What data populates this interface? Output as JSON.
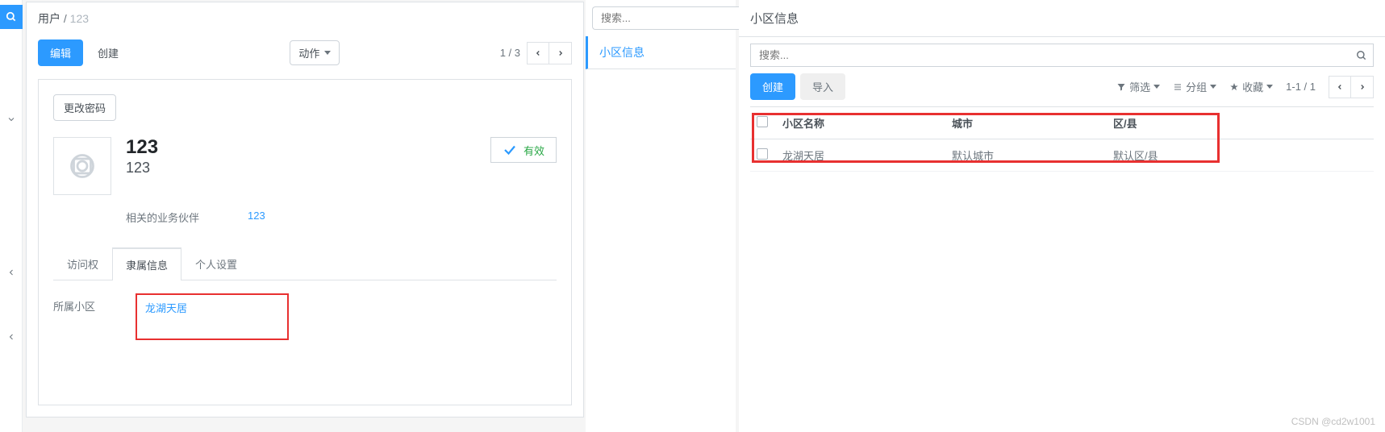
{
  "left": {
    "breadcrumb_module": "用户",
    "breadcrumb_sep": " / ",
    "breadcrumb_current": "123",
    "edit_label": "编辑",
    "create_label": "创建",
    "action_label": "动作",
    "pager": "1 / 3",
    "change_pw": "更改密码",
    "name": "123",
    "login": "123",
    "related_label": "相关的业务伙伴",
    "related_value": "123",
    "tabs": [
      "访问权",
      "隶属信息",
      "个人设置"
    ],
    "status_label": "有效",
    "field_label": "所属小区",
    "field_value": "龙湖天居"
  },
  "mid": {
    "search_placeholder": "搜索...",
    "side_link": "小区信息"
  },
  "right": {
    "title": "小区信息",
    "search_placeholder": "搜索...",
    "create_label": "创建",
    "import_label": "导入",
    "filter_label": "筛选",
    "group_label": "分组",
    "favorite_label": "收藏",
    "pager": "1-1 / 1",
    "columns": [
      "小区名称",
      "城市",
      "区/县"
    ],
    "rows": [
      {
        "name": "龙湖天居",
        "city": "默认城市",
        "district": "默认区/县"
      }
    ]
  },
  "watermark": "CSDN @cd2w1001"
}
